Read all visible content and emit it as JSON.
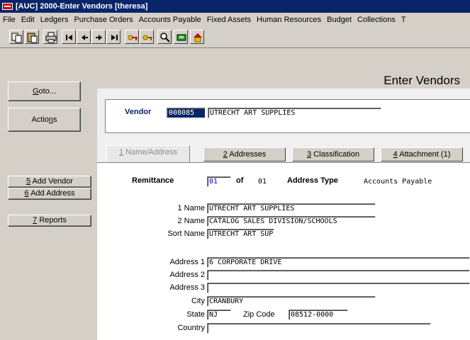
{
  "window": {
    "title": "[AUC] 2000-Enter Vendors [theresa]"
  },
  "menu": [
    "File",
    "Edit",
    "Ledgers",
    "Purchase Orders",
    "Accounts Payable",
    "Fixed Assets",
    "Human Resources",
    "Budget",
    "Collections",
    "T"
  ],
  "toolbar_icons": [
    "copy-icon",
    "paste-icon",
    "print-icon",
    "first-record-icon",
    "previous-record-icon",
    "next-record-icon",
    "last-record-icon",
    "keys-icon",
    "keys-alt-icon",
    "search-icon",
    "save-icon",
    "home-icon"
  ],
  "page_title": "Enter Vendors",
  "left_buttons": {
    "goto": {
      "pre": "",
      "key": "G",
      "post": "oto..."
    },
    "actions": {
      "pre": "Actio",
      "key": "n",
      "post": "s"
    },
    "add_vendor": {
      "pre": "",
      "key": "5",
      "post": " Add Vendor"
    },
    "add_address": {
      "pre": "",
      "key": "6",
      "post": " Add Address"
    },
    "reports": {
      "pre": "",
      "key": "7",
      "post": " Reports"
    }
  },
  "vendor": {
    "label": "Vendor",
    "code": "008085",
    "name": "UTRECHT ART SUPPLIES"
  },
  "tabs": [
    {
      "key": "1",
      "label": " Name/Address",
      "active": true
    },
    {
      "key": "2",
      "label": " Addresses",
      "active": false
    },
    {
      "key": "3",
      "label": " Classification",
      "active": false
    },
    {
      "key": "4",
      "label": " Attachment (1)",
      "active": false
    }
  ],
  "remittance": {
    "label": "Remittance",
    "value": "01",
    "of_label": "of",
    "total": "01",
    "address_type_label": "Address Type",
    "address_type": "Accounts Payable"
  },
  "names": {
    "name1_label": "1 Name",
    "name1": "UTRECHT ART SUPPLIES",
    "name2_label": "2 Name",
    "name2": "CATALOG SALES DIVISION/SCHOOLS",
    "sort_label": "Sort Name",
    "sort": "UTRECHT ART SUP"
  },
  "address": {
    "address1_label": "Address 1",
    "address1": "6 CORPORATE DRIVE",
    "address2_label": "Address 2",
    "address2": "",
    "address3_label": "Address 3",
    "address3": "",
    "city_label": "City",
    "city": "CRANBURY",
    "state_label": "State",
    "state": "NJ",
    "zip_label": "Zip Code",
    "zip": "08512-0000",
    "country_label": "Country",
    "country": ""
  }
}
